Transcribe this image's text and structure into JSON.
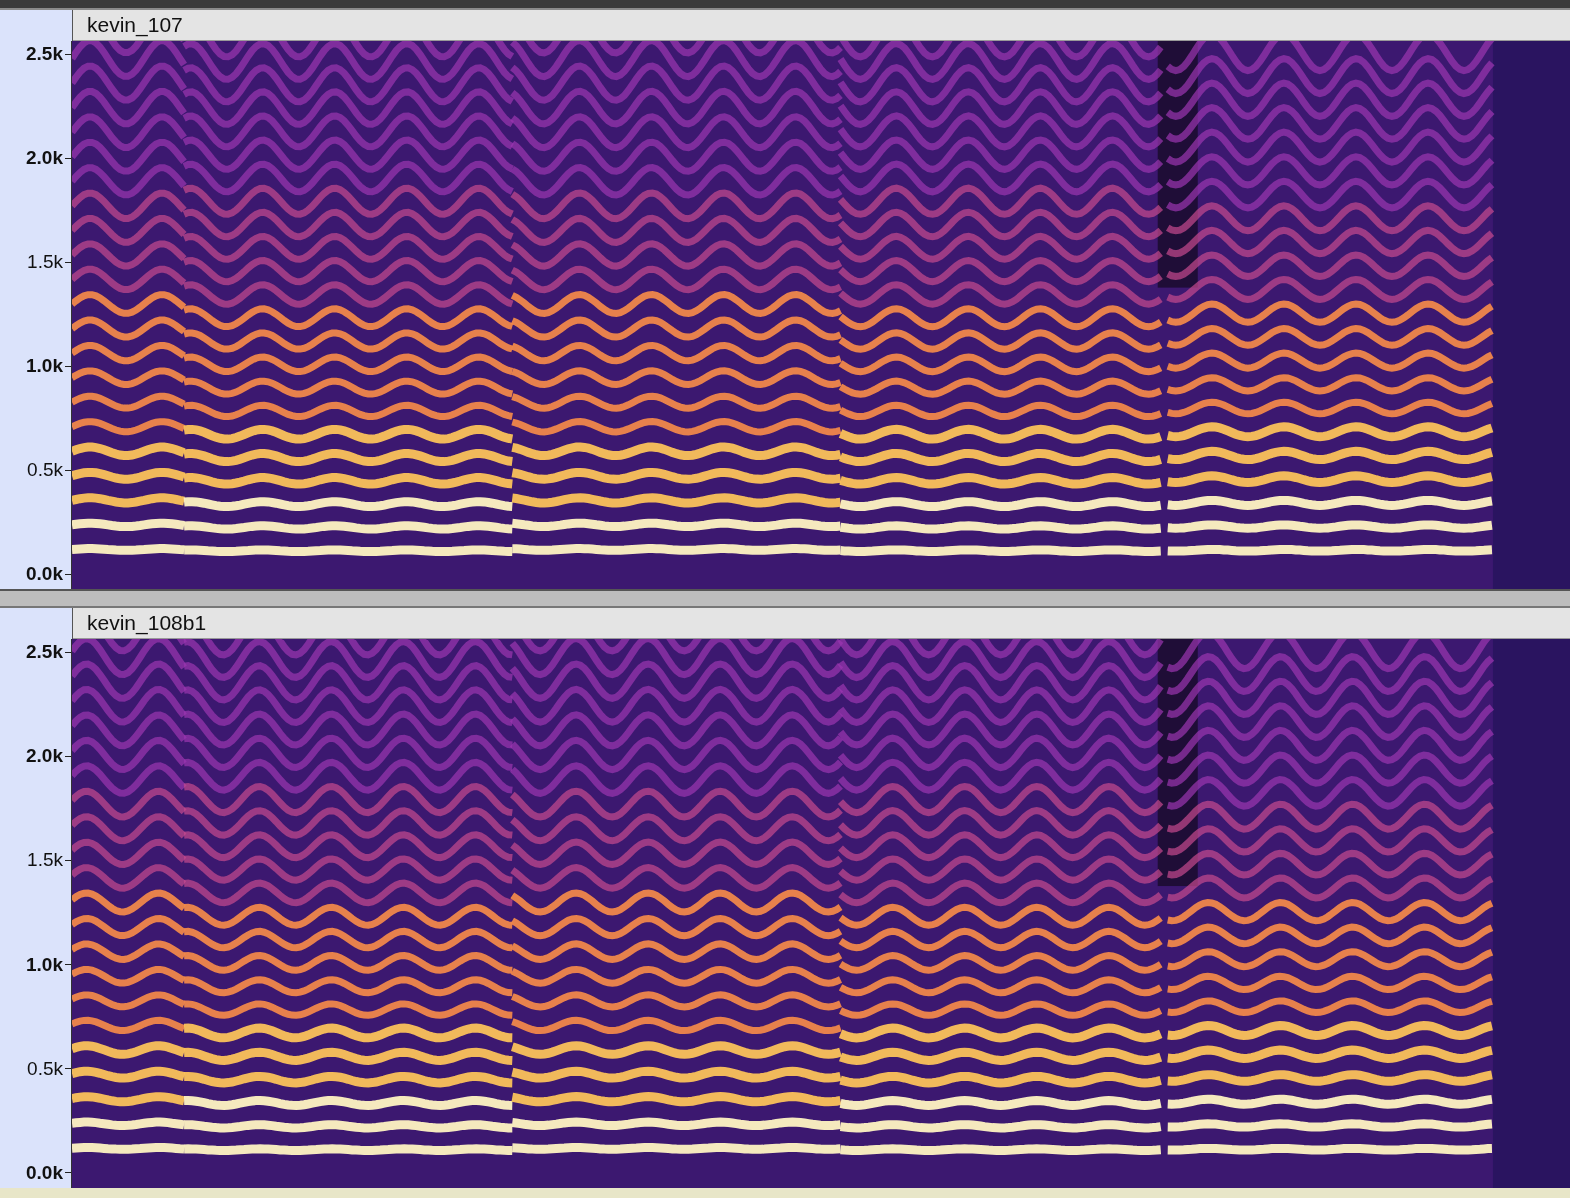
{
  "tracks": [
    {
      "name": "kevin_107",
      "axis": [
        {
          "label": "2.5k",
          "major": true
        },
        {
          "label": "2.0k",
          "major": true
        },
        {
          "label": "1.5k",
          "major": false
        },
        {
          "label": "1.0k",
          "major": true
        },
        {
          "label": "0.5k",
          "major": false
        },
        {
          "label": "0.0k",
          "major": true
        }
      ]
    },
    {
      "name": "kevin_108b1",
      "axis": [
        {
          "label": "2.5k",
          "major": true
        },
        {
          "label": "2.0k",
          "major": true
        },
        {
          "label": "1.5k",
          "major": false
        },
        {
          "label": "1.0k",
          "major": true
        },
        {
          "label": "0.5k",
          "major": false
        },
        {
          "label": "0.0k",
          "major": true
        }
      ]
    }
  ]
}
